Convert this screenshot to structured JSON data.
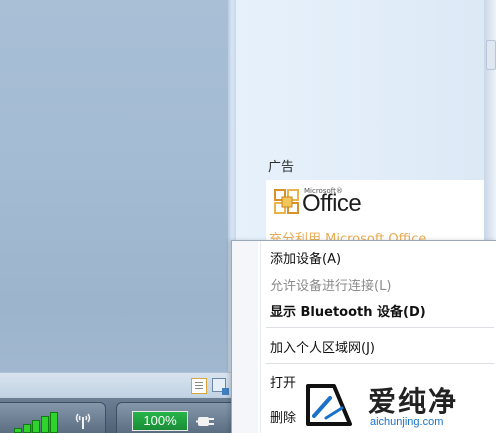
{
  "ad_panel": {
    "label": "广告",
    "brand_small": "Microsoft®",
    "brand": "Office",
    "tagline": "充分利用 Microsoft Office"
  },
  "context_menu": {
    "items": [
      {
        "label": "添加设备(A)",
        "state": "enabled"
      },
      {
        "label": "允许设备进行连接(L)",
        "state": "disabled"
      },
      {
        "label": "显示 Bluetooth 设备(D)",
        "state": "default"
      },
      {
        "label": "加入个人区域网(J)",
        "state": "enabled"
      },
      {
        "label": "打开",
        "state": "enabled"
      },
      {
        "label": "删除",
        "state": "enabled"
      }
    ]
  },
  "tray": {
    "battery_label": "100%",
    "battery_level": 1.0,
    "signal_icon": "signal-strength-icon",
    "wireless_icon": "wireless-antenna-icon",
    "plug_icon": "power-plug-icon"
  },
  "watermark": {
    "text": "爱纯净",
    "url": "aichunjing.com"
  },
  "colors": {
    "desktop": "#a3bbd3",
    "ad_text": "#e39a2a",
    "battery_green": "#1b8c37",
    "signal_green": "#2fd32b",
    "watermark_url": "#1a73c8"
  }
}
